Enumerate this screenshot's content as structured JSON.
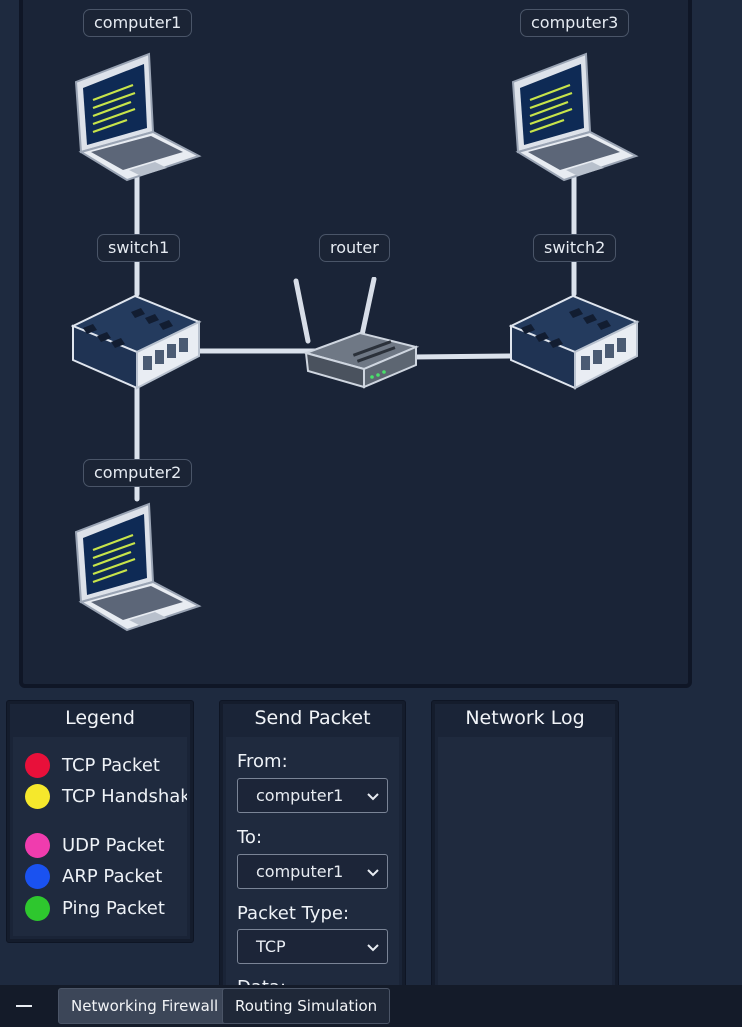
{
  "network": {
    "nodes": {
      "computer1": {
        "label": "computer1",
        "type": "laptop"
      },
      "computer2": {
        "label": "computer2",
        "type": "laptop"
      },
      "computer3": {
        "label": "computer3",
        "type": "laptop"
      },
      "switch1": {
        "label": "switch1",
        "type": "switch"
      },
      "switch2": {
        "label": "switch2",
        "type": "switch"
      },
      "router": {
        "label": "router",
        "type": "router"
      }
    }
  },
  "legend": {
    "title": "Legend",
    "items": [
      {
        "label": "TCP Packet",
        "color": "#e8103a"
      },
      {
        "label": "TCP Handshake",
        "color": "#f5e82c"
      },
      {
        "label": "UDP Packet",
        "color": "#f03cae"
      },
      {
        "label": "ARP Packet",
        "color": "#1a52f0"
      },
      {
        "label": "Ping Packet",
        "color": "#2ec72e"
      }
    ]
  },
  "send_packet": {
    "title": "Send Packet",
    "from_label": "From:",
    "from_value": "computer1",
    "to_label": "To:",
    "to_value": "computer1",
    "type_label": "Packet Type:",
    "type_value": "TCP",
    "data_label": "Data:"
  },
  "network_log": {
    "title": "Network Log"
  },
  "taskbar": {
    "menu_icon": "minimize-icon",
    "tabs": [
      {
        "label": "Networking Firewall"
      },
      {
        "label": "Routing Simulation"
      }
    ]
  }
}
